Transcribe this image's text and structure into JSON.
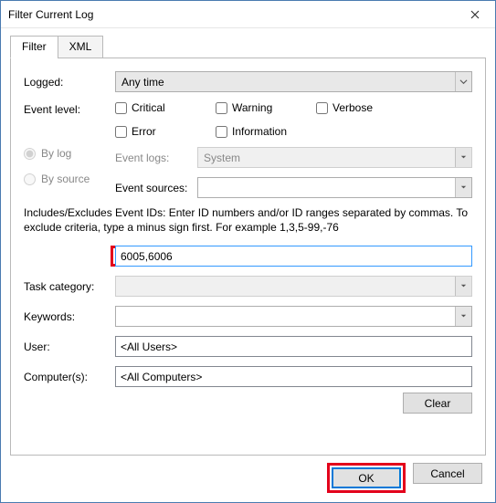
{
  "window": {
    "title": "Filter Current Log"
  },
  "tabs": {
    "active": "Filter",
    "other": "XML"
  },
  "logged": {
    "label": "Logged:",
    "value": "Any time"
  },
  "level": {
    "label": "Event level:",
    "critical": "Critical",
    "warning": "Warning",
    "verbose": "Verbose",
    "error": "Error",
    "information": "Information"
  },
  "mode": {
    "bylog": "By log",
    "bysource": "By source"
  },
  "eventlogs": {
    "label": "Event logs:",
    "value": "System"
  },
  "eventsources": {
    "label": "Event sources:",
    "value": ""
  },
  "help": "Includes/Excludes Event IDs: Enter ID numbers and/or ID ranges separated by commas. To exclude criteria, type a minus sign first. For example 1,3,5-99,-76",
  "ids": {
    "value": "6005,6006"
  },
  "taskcat": {
    "label": "Task category:",
    "value": ""
  },
  "keywords": {
    "label": "Keywords:",
    "value": ""
  },
  "user": {
    "label": "User:",
    "value": "<All Users>"
  },
  "computers": {
    "label": "Computer(s):",
    "value": "<All Computers>"
  },
  "buttons": {
    "clear": "Clear",
    "ok": "OK",
    "cancel": "Cancel"
  }
}
